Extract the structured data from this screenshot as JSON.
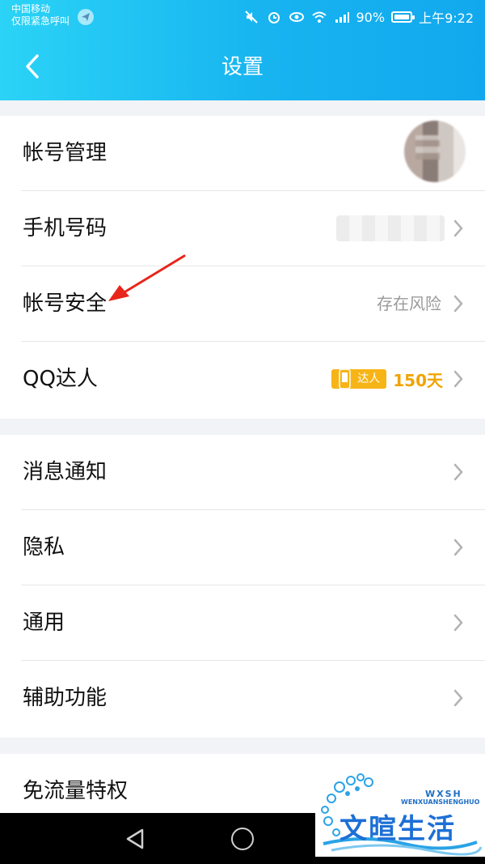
{
  "status_bar": {
    "carrier_line1": "中国移动",
    "carrier_line2": "仅限紧急呼叫",
    "battery": "90%",
    "time": "上午9:22",
    "icons": [
      "telegram-icon",
      "mute-icon",
      "alarm-icon",
      "eye-icon",
      "wifi-icon",
      "signal-icon",
      "battery-icon"
    ]
  },
  "nav": {
    "title": "设置",
    "back_icon": "chevron-left-icon"
  },
  "groups": [
    {
      "items": [
        {
          "label": "帐号管理",
          "right": "avatar"
        },
        {
          "label": "手机号码",
          "right": "blurred-phone"
        },
        {
          "label": "帐号安全",
          "value": "存在风险"
        },
        {
          "label": "QQ达人",
          "badge": "达人",
          "days": "150天"
        }
      ]
    },
    {
      "items": [
        {
          "label": "消息通知"
        },
        {
          "label": "隐私"
        },
        {
          "label": "通用"
        },
        {
          "label": "辅助功能"
        }
      ]
    },
    {
      "items": [
        {
          "label": "免流量特权"
        }
      ]
    }
  ],
  "watermark": {
    "text": "文暄生活",
    "subtext": "WENXUANSHENGHUO",
    "small": "WXSH"
  },
  "colors": {
    "header_start": "#2bd3f6",
    "header_end": "#12a8ee",
    "badge": "#f7b417",
    "arrow": "#e8251b"
  }
}
